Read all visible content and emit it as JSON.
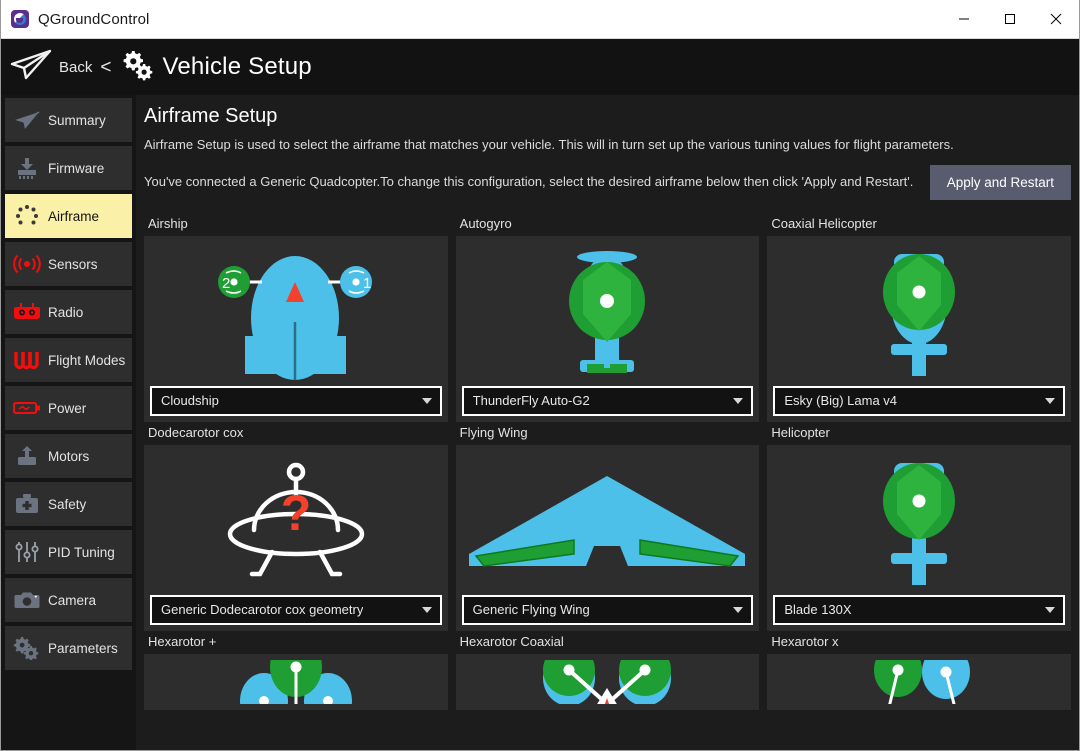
{
  "window": {
    "title": "QGroundControl",
    "app_icon": "qgroundcontrol-logo-icon",
    "controls": {
      "minimize": "minimize-icon",
      "maximize": "maximize-icon",
      "close": "close-icon"
    }
  },
  "header": {
    "logo_icon": "paper-plane-icon",
    "back_label": "Back",
    "back_chevron": "<",
    "gears_icon": "gears-icon",
    "title": "Vehicle Setup"
  },
  "sidebar": {
    "items": [
      {
        "label": "Summary",
        "icon": "paper-plane-icon",
        "selected": false
      },
      {
        "label": "Firmware",
        "icon": "download-chip-icon",
        "selected": false
      },
      {
        "label": "Airframe",
        "icon": "airframe-dots-icon",
        "selected": true
      },
      {
        "label": "Sensors",
        "icon": "sensor-waves-icon",
        "selected": false
      },
      {
        "label": "Radio",
        "icon": "radio-controller-icon",
        "selected": false
      },
      {
        "label": "Flight Modes",
        "icon": "flight-modes-icon",
        "selected": false
      },
      {
        "label": "Power",
        "icon": "battery-icon",
        "selected": false
      },
      {
        "label": "Motors",
        "icon": "motor-icon",
        "selected": false
      },
      {
        "label": "Safety",
        "icon": "first-aid-kit-icon",
        "selected": false
      },
      {
        "label": "PID Tuning",
        "icon": "sliders-icon",
        "selected": false
      },
      {
        "label": "Camera",
        "icon": "camera-icon",
        "selected": false
      },
      {
        "label": "Parameters",
        "icon": "gears-icon",
        "selected": false
      }
    ]
  },
  "main": {
    "title": "Airframe Setup",
    "description_1": "Airframe Setup is used to select the airframe that matches your vehicle. This will in turn set up the various tuning values for flight parameters.",
    "description_2": "You've connected a Generic Quadcopter.To change this configuration, select the desired airframe below then click 'Apply and Restart'.",
    "apply_button": "Apply and Restart",
    "airframes": [
      {
        "label": "Airship",
        "selection": "Cloudship",
        "art": "airship",
        "clipped": false
      },
      {
        "label": "Autogyro",
        "selection": "ThunderFly Auto-G2",
        "art": "autogyro",
        "clipped": false
      },
      {
        "label": "Coaxial Helicopter",
        "selection": "Esky (Big) Lama v4",
        "art": "coaxheli",
        "clipped": false
      },
      {
        "label": "Dodecarotor cox",
        "selection": "Generic Dodecarotor cox geometry",
        "art": "unknown",
        "clipped": false
      },
      {
        "label": "Flying Wing",
        "selection": "Generic Flying Wing",
        "art": "flyingwing",
        "clipped": false
      },
      {
        "label": "Helicopter",
        "selection": "Blade 130X",
        "art": "helicopter",
        "clipped": false
      },
      {
        "label": "Hexarotor +",
        "selection": "",
        "art": "hexplus",
        "clipped": true
      },
      {
        "label": "Hexarotor Coaxial",
        "selection": "",
        "art": "hexcoax",
        "clipped": true
      },
      {
        "label": "Hexarotor x",
        "selection": "",
        "art": "hexx",
        "clipped": true
      }
    ]
  },
  "colors": {
    "accent_selected": "#fbf0a8",
    "page_background": "#1c1c1c",
    "card_background": "#2d2d2d",
    "sidebar_background": "#151515",
    "button_background": "#585c6e",
    "rotor_green": "#1f9e33",
    "rotor_blue": "#4cc0e8",
    "marker_red": "#f4412c",
    "icon_red": "#f40d0d"
  }
}
